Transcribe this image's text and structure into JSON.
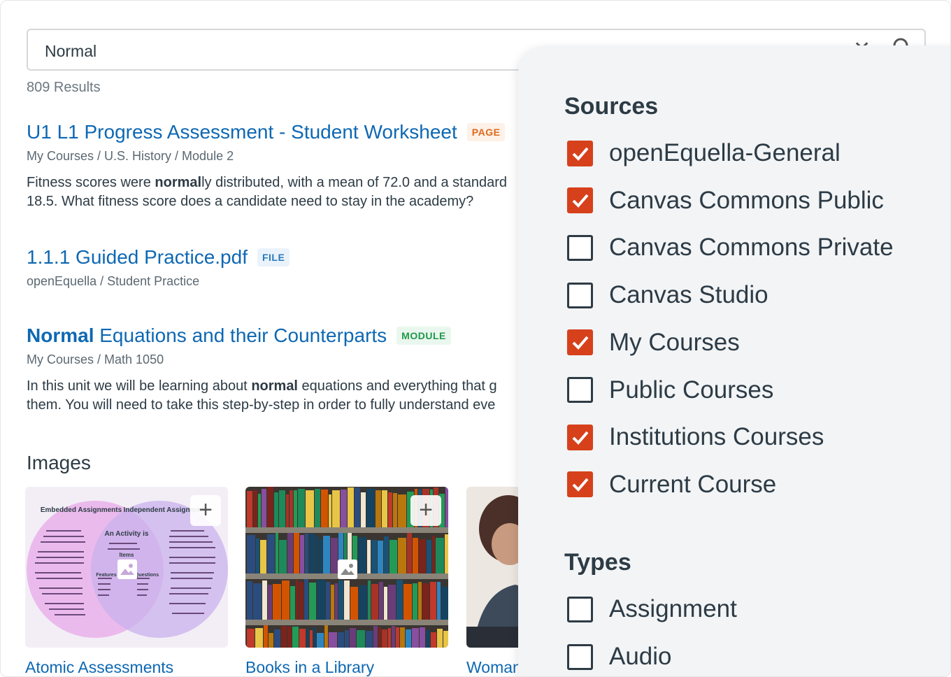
{
  "search": {
    "value": "Normal"
  },
  "results_count": "809 Results",
  "results": [
    {
      "title": "U1 L1 Progress Assessment - Student Worksheet",
      "badge": "PAGE",
      "path": "My Courses / U.S. History / Module 2",
      "desc_line1_pre": "Fitness scores were ",
      "desc_line1_bold": "normal",
      "desc_line1_post": "ly distributed, with a mean of 72.0 and a standard",
      "desc_line2": "18.5. What fitness score does a candidate need to stay in the academy?"
    },
    {
      "title": "1.1.1 Guided Practice.pdf",
      "badge": "FILE",
      "path": "openEquella / Student Practice"
    },
    {
      "title_bold": "Normal",
      "title_rest": " Equations and their Counterparts",
      "badge": "MODULE",
      "path": "My Courses / Math 1050",
      "desc_line1_pre": "In this unit we will be learning about ",
      "desc_line1_bold": "normal",
      "desc_line1_post": " equations and everything that g",
      "desc_line2": "them. You will need to take this step-by-step in order to fully understand eve"
    }
  ],
  "images_heading": "Images",
  "images": [
    {
      "label": "Atomic Assessments",
      "diagram": {
        "left_title": "Embedded Assignments",
        "right_title": "Independent Assignment",
        "center_title": "An Activity is",
        "center_sub": "Items",
        "features": "Features",
        "questions": "Questions"
      }
    },
    {
      "label": "Books in a Library"
    },
    {
      "label": "Woman"
    }
  ],
  "filters": {
    "sources_heading": "Sources",
    "sources": [
      {
        "label": "openEquella-General",
        "checked": true
      },
      {
        "label": "Canvas Commons Public",
        "checked": true
      },
      {
        "label": "Canvas Commons Private",
        "checked": false
      },
      {
        "label": "Canvas Studio",
        "checked": false
      },
      {
        "label": "My Courses",
        "checked": true
      },
      {
        "label": "Public Courses",
        "checked": false
      },
      {
        "label": "Institutions Courses",
        "checked": true
      },
      {
        "label": "Current Course",
        "checked": true
      }
    ],
    "types_heading": "Types",
    "types": [
      {
        "label": "Assignment",
        "checked": false
      },
      {
        "label": "Audio",
        "checked": false
      }
    ]
  },
  "colors": {
    "link": "#0e68b3",
    "checkbox_checked": "#d6411c",
    "panel_bg": "#f2f4f6"
  }
}
